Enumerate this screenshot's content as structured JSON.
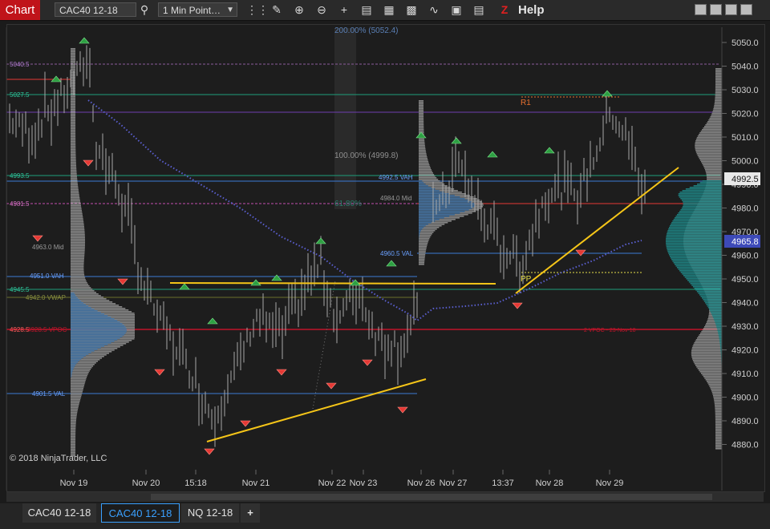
{
  "toolbar": {
    "title_tab": "Chart",
    "instrument": "CAC40 12-18",
    "interval": "1 Min Point…",
    "help_label": "Help",
    "icons": [
      "search-icon",
      "bars-icon",
      "pencil-icon",
      "zoom-in-icon",
      "zoom-out-icon",
      "crosshair-icon",
      "data-box-icon",
      "indicators-icon",
      "strategies-icon",
      "drawing-tools-icon",
      "templates-icon",
      "properties-icon",
      "z-icon"
    ]
  },
  "colors": {
    "title_tab": "#c0141a",
    "up_marker": "#2ea043",
    "down_marker": "#e53935",
    "trendline": "#f5c518",
    "vwap_dots": "#5a5fd0",
    "profile_left": "#3a6ea5",
    "profile_right": "#2aa9a9",
    "active_tab": "#3aa0ff"
  },
  "price_axis": {
    "ticks": [
      "5050.0",
      "5040.0",
      "5030.0",
      "5020.0",
      "5010.0",
      "5000.0",
      "4990.0",
      "4980.0",
      "4970.0",
      "4960.0",
      "4950.0",
      "4940.0",
      "4930.0",
      "4920.0",
      "4910.0",
      "4900.0",
      "4890.0",
      "4880.0"
    ],
    "current_price": "4992.5",
    "marker_price": "4965.8"
  },
  "time_axis": [
    "Nov 19",
    "Nov 20",
    "15:18",
    "Nov 21",
    "Nov 22",
    "Nov 23",
    "Nov 26",
    "Nov 27",
    "13:37",
    "Nov 28",
    "Nov 29"
  ],
  "level_labels": {
    "l5040": "5040.5",
    "l5027": "5027.5",
    "l4993": "4993.5",
    "l4981": "4981.5",
    "l4963mid": "4963.0 Mid",
    "l4951vah": "4951.0 VAH",
    "l4945": "4945.5",
    "l4942vwap": "4942.0 VWAP",
    "l4928": "4928.5",
    "l4928vpoc": "4928.5 VPOC",
    "l4901val": "4901.5 VAL",
    "l4992vah": "4992.5 VAH",
    "l4984mid": "4984.0 Mid",
    "l4960val": "4960.5 VAL",
    "fib200": "200.00% (5052.4)",
    "fib100": "100.00% (4999.8)",
    "fib61": "61.80%",
    "r1": "R1",
    "pp": "PP",
    "vpoc_right": "2 VPOC - 23-Nov-18"
  },
  "copyright": "© 2018 NinjaTrader, LLC",
  "tabs": [
    "CAC40 12-18",
    "CAC40 12-18",
    "NQ 12-18"
  ],
  "add_tab_label": "+"
}
